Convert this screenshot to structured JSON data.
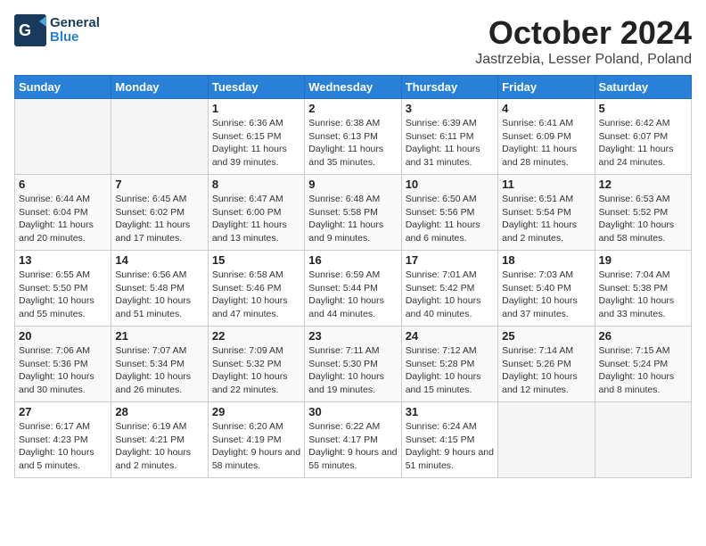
{
  "logo": {
    "line1": "General",
    "line2": "Blue"
  },
  "title": "October 2024",
  "location": "Jastrzebia, Lesser Poland, Poland",
  "weekdays": [
    "Sunday",
    "Monday",
    "Tuesday",
    "Wednesday",
    "Thursday",
    "Friday",
    "Saturday"
  ],
  "weeks": [
    [
      {
        "day": "",
        "empty": true
      },
      {
        "day": "",
        "empty": true
      },
      {
        "day": "1",
        "sunrise": "6:36 AM",
        "sunset": "6:15 PM",
        "daylight": "11 hours and 39 minutes."
      },
      {
        "day": "2",
        "sunrise": "6:38 AM",
        "sunset": "6:13 PM",
        "daylight": "11 hours and 35 minutes."
      },
      {
        "day": "3",
        "sunrise": "6:39 AM",
        "sunset": "6:11 PM",
        "daylight": "11 hours and 31 minutes."
      },
      {
        "day": "4",
        "sunrise": "6:41 AM",
        "sunset": "6:09 PM",
        "daylight": "11 hours and 28 minutes."
      },
      {
        "day": "5",
        "sunrise": "6:42 AM",
        "sunset": "6:07 PM",
        "daylight": "11 hours and 24 minutes."
      }
    ],
    [
      {
        "day": "6",
        "sunrise": "6:44 AM",
        "sunset": "6:04 PM",
        "daylight": "11 hours and 20 minutes."
      },
      {
        "day": "7",
        "sunrise": "6:45 AM",
        "sunset": "6:02 PM",
        "daylight": "11 hours and 17 minutes."
      },
      {
        "day": "8",
        "sunrise": "6:47 AM",
        "sunset": "6:00 PM",
        "daylight": "11 hours and 13 minutes."
      },
      {
        "day": "9",
        "sunrise": "6:48 AM",
        "sunset": "5:58 PM",
        "daylight": "11 hours and 9 minutes."
      },
      {
        "day": "10",
        "sunrise": "6:50 AM",
        "sunset": "5:56 PM",
        "daylight": "11 hours and 6 minutes."
      },
      {
        "day": "11",
        "sunrise": "6:51 AM",
        "sunset": "5:54 PM",
        "daylight": "11 hours and 2 minutes."
      },
      {
        "day": "12",
        "sunrise": "6:53 AM",
        "sunset": "5:52 PM",
        "daylight": "10 hours and 58 minutes."
      }
    ],
    [
      {
        "day": "13",
        "sunrise": "6:55 AM",
        "sunset": "5:50 PM",
        "daylight": "10 hours and 55 minutes."
      },
      {
        "day": "14",
        "sunrise": "6:56 AM",
        "sunset": "5:48 PM",
        "daylight": "10 hours and 51 minutes."
      },
      {
        "day": "15",
        "sunrise": "6:58 AM",
        "sunset": "5:46 PM",
        "daylight": "10 hours and 47 minutes."
      },
      {
        "day": "16",
        "sunrise": "6:59 AM",
        "sunset": "5:44 PM",
        "daylight": "10 hours and 44 minutes."
      },
      {
        "day": "17",
        "sunrise": "7:01 AM",
        "sunset": "5:42 PM",
        "daylight": "10 hours and 40 minutes."
      },
      {
        "day": "18",
        "sunrise": "7:03 AM",
        "sunset": "5:40 PM",
        "daylight": "10 hours and 37 minutes."
      },
      {
        "day": "19",
        "sunrise": "7:04 AM",
        "sunset": "5:38 PM",
        "daylight": "10 hours and 33 minutes."
      }
    ],
    [
      {
        "day": "20",
        "sunrise": "7:06 AM",
        "sunset": "5:36 PM",
        "daylight": "10 hours and 30 minutes."
      },
      {
        "day": "21",
        "sunrise": "7:07 AM",
        "sunset": "5:34 PM",
        "daylight": "10 hours and 26 minutes."
      },
      {
        "day": "22",
        "sunrise": "7:09 AM",
        "sunset": "5:32 PM",
        "daylight": "10 hours and 22 minutes."
      },
      {
        "day": "23",
        "sunrise": "7:11 AM",
        "sunset": "5:30 PM",
        "daylight": "10 hours and 19 minutes."
      },
      {
        "day": "24",
        "sunrise": "7:12 AM",
        "sunset": "5:28 PM",
        "daylight": "10 hours and 15 minutes."
      },
      {
        "day": "25",
        "sunrise": "7:14 AM",
        "sunset": "5:26 PM",
        "daylight": "10 hours and 12 minutes."
      },
      {
        "day": "26",
        "sunrise": "7:15 AM",
        "sunset": "5:24 PM",
        "daylight": "10 hours and 8 minutes."
      }
    ],
    [
      {
        "day": "27",
        "sunrise": "6:17 AM",
        "sunset": "4:23 PM",
        "daylight": "10 hours and 5 minutes."
      },
      {
        "day": "28",
        "sunrise": "6:19 AM",
        "sunset": "4:21 PM",
        "daylight": "10 hours and 2 minutes."
      },
      {
        "day": "29",
        "sunrise": "6:20 AM",
        "sunset": "4:19 PM",
        "daylight": "9 hours and 58 minutes."
      },
      {
        "day": "30",
        "sunrise": "6:22 AM",
        "sunset": "4:17 PM",
        "daylight": "9 hours and 55 minutes."
      },
      {
        "day": "31",
        "sunrise": "6:24 AM",
        "sunset": "4:15 PM",
        "daylight": "9 hours and 51 minutes."
      },
      {
        "day": "",
        "empty": true
      },
      {
        "day": "",
        "empty": true
      }
    ]
  ]
}
